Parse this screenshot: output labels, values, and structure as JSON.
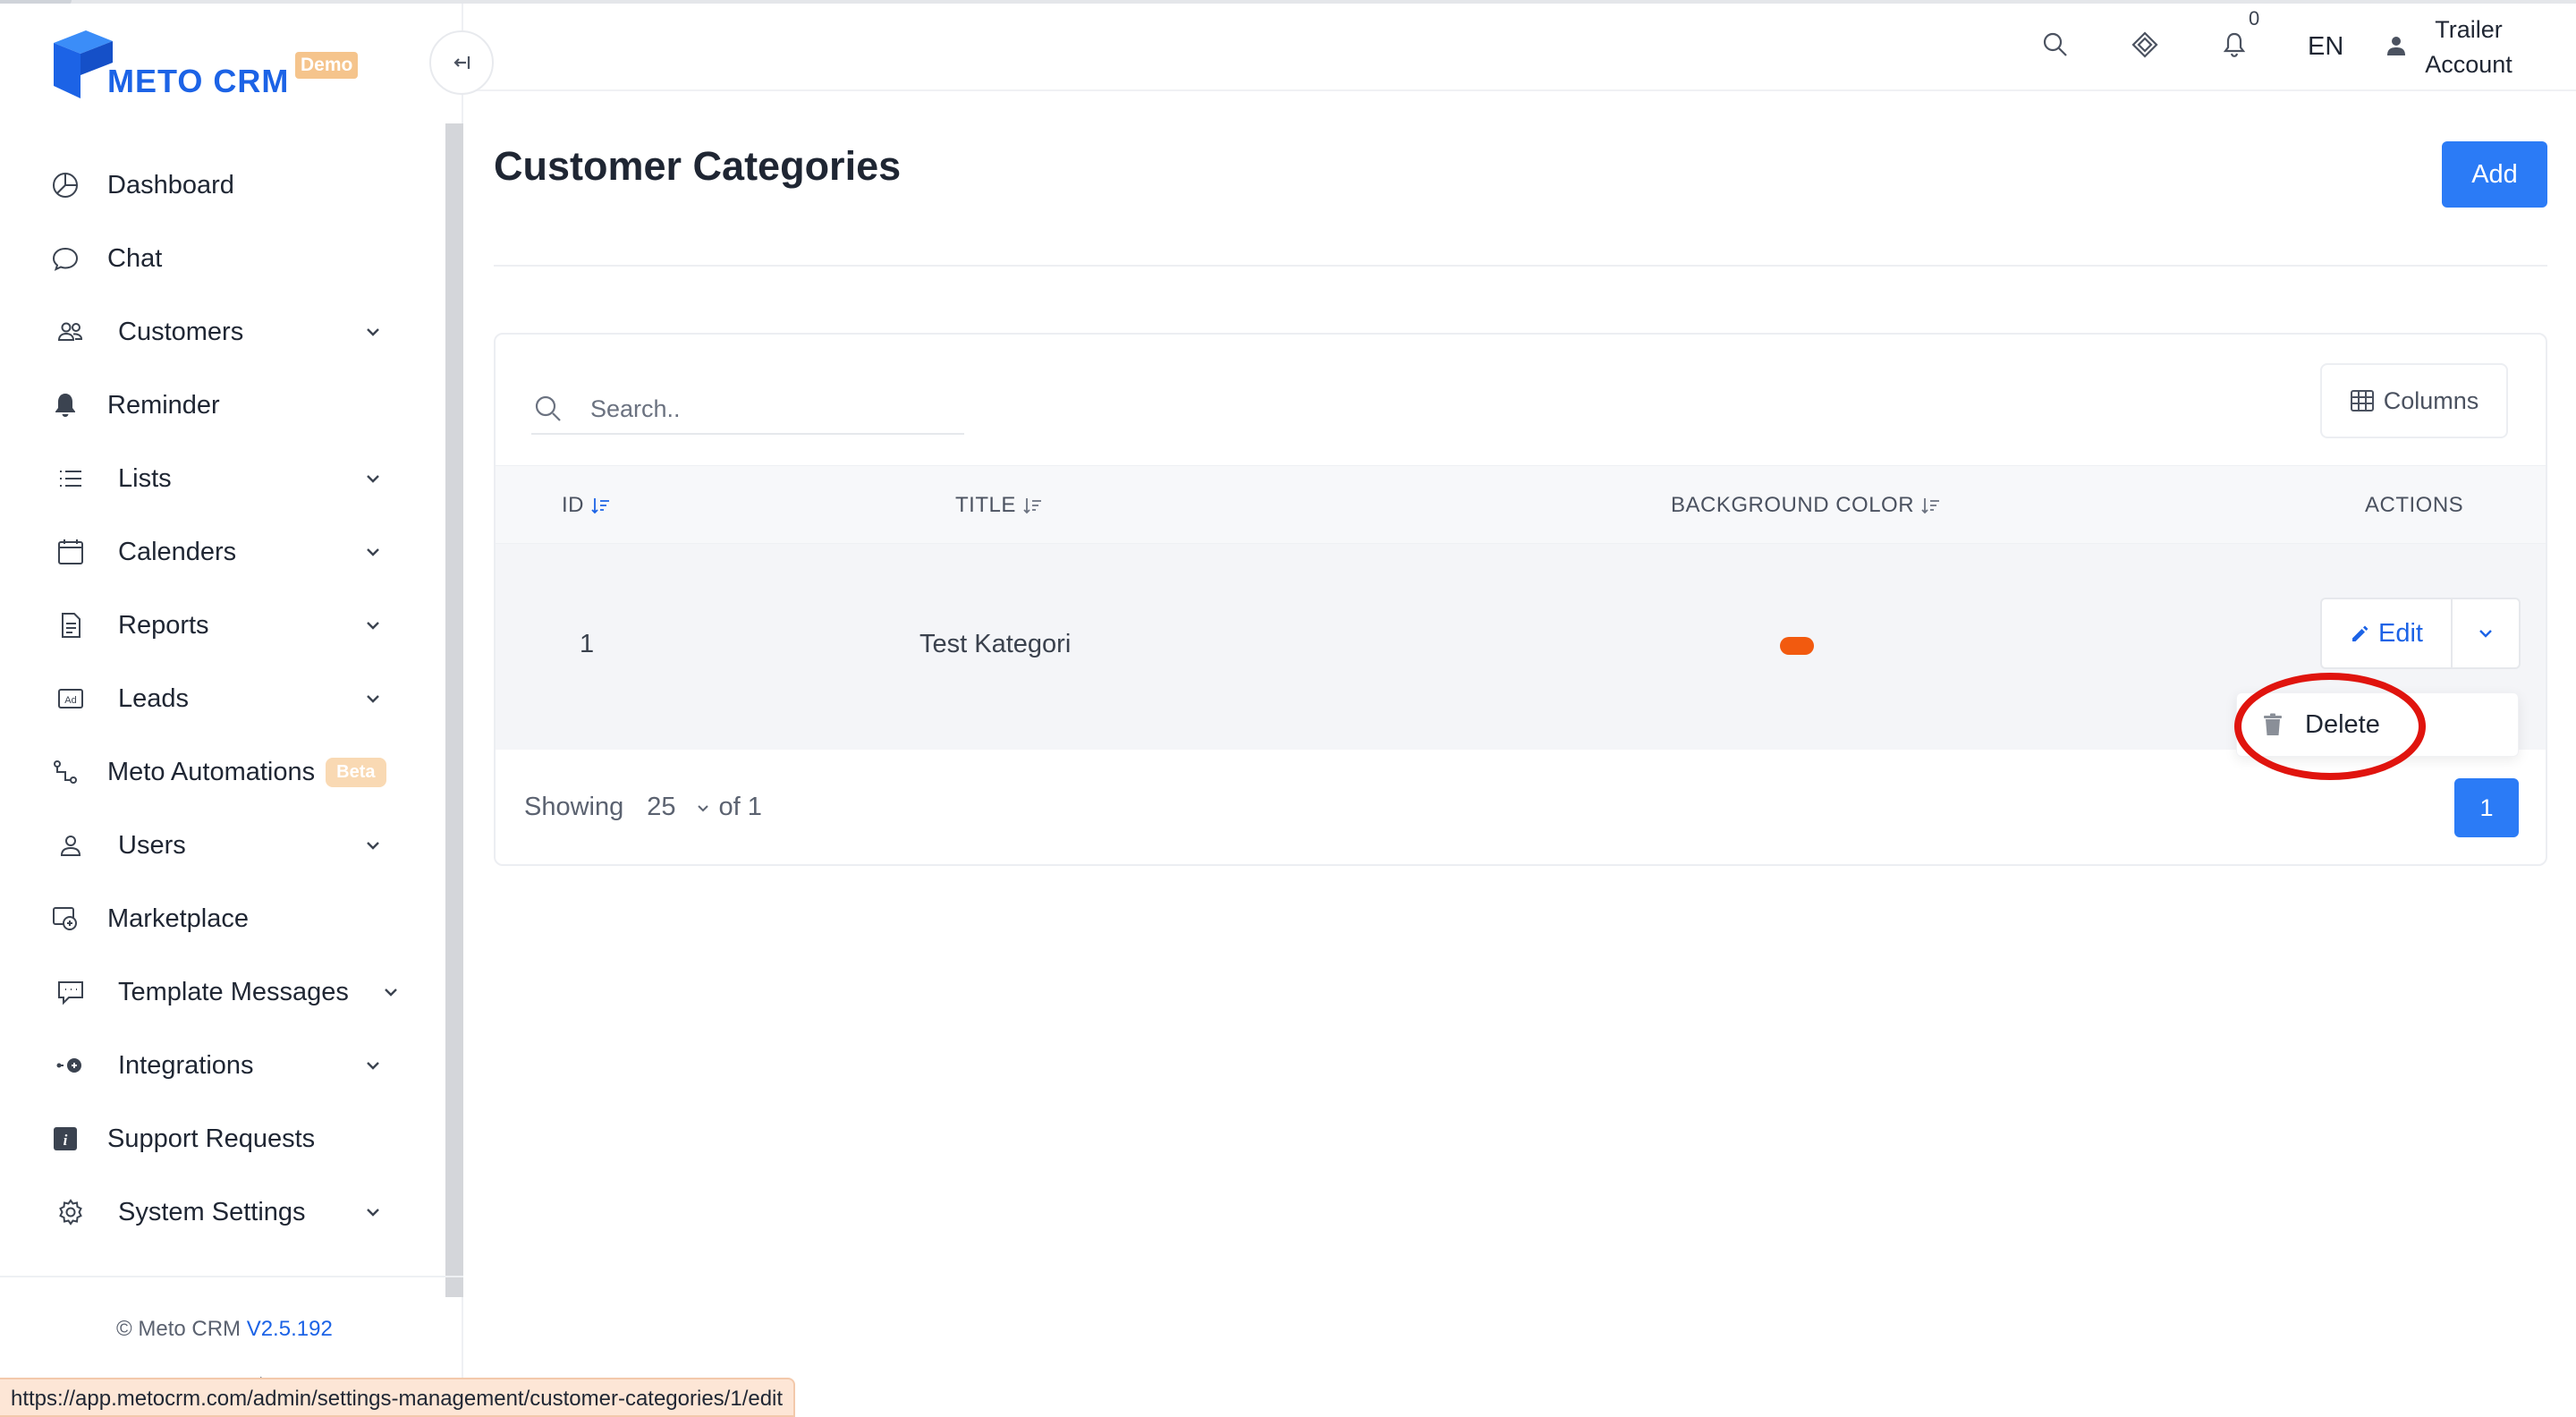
{
  "app": {
    "logo_text": "METO CRM",
    "logo_badge": "Demo",
    "brand_color": "#1c63e6"
  },
  "header": {
    "notification_count": "0",
    "language": "EN",
    "user_line1": "Trailer",
    "user_line2": "Account",
    "icons": [
      "search-icon",
      "puzzle-icon",
      "bell-icon",
      "user-icon"
    ]
  },
  "sidebar": {
    "items": [
      {
        "label": "Dashboard",
        "icon": "pie-chart-icon",
        "has_children": false
      },
      {
        "label": "Chat",
        "icon": "chat-bubble-icon",
        "has_children": false
      },
      {
        "label": "Customers",
        "icon": "users-icon",
        "has_children": true
      },
      {
        "label": "Reminder",
        "icon": "bell-icon",
        "has_children": false
      },
      {
        "label": "Lists",
        "icon": "list-icon",
        "has_children": true
      },
      {
        "label": "Calenders",
        "icon": "calendar-icon",
        "has_children": true
      },
      {
        "label": "Reports",
        "icon": "document-icon",
        "has_children": true
      },
      {
        "label": "Leads",
        "icon": "ad-icon",
        "has_children": true
      },
      {
        "label": "Meto Automations",
        "icon": "automation-icon",
        "has_children": false,
        "badge": "Beta"
      },
      {
        "label": "Users",
        "icon": "user-icon",
        "has_children": true
      },
      {
        "label": "Marketplace",
        "icon": "marketplace-icon",
        "has_children": false
      },
      {
        "label": "Template Messages",
        "icon": "message-template-icon",
        "has_children": true
      },
      {
        "label": "Integrations",
        "icon": "integration-icon",
        "has_children": true
      },
      {
        "label": "Support Requests",
        "icon": "info-icon",
        "has_children": false
      },
      {
        "label": "System Settings",
        "icon": "gear-icon",
        "has_children": true
      }
    ],
    "footer_copyright": "© Meto CRM",
    "footer_version": "V2.5.192",
    "footer_arrow": ">"
  },
  "main": {
    "title": "Customer Categories",
    "add_label": "Add",
    "search_placeholder": "Search..",
    "columns_label": "Columns",
    "table": {
      "headers": [
        "ID",
        "TITLE",
        "BACKGROUND COLOR",
        "ACTIONS"
      ],
      "rows": [
        {
          "id": "1",
          "title": "Test Kategori",
          "background_color": "#f25a0f"
        }
      ]
    },
    "edit_label": "Edit",
    "dropdown": {
      "delete_label": "Delete"
    },
    "footer": {
      "showing_label": "Showing",
      "per_page": "25",
      "of_label": "of 1"
    },
    "current_page": "1"
  },
  "status_bar_url": "https://app.metocrm.com/admin/settings-management/customer-categories/1/edit",
  "colors": {
    "accent": "#2b7bf6",
    "annotation_ring": "#e0140e"
  }
}
